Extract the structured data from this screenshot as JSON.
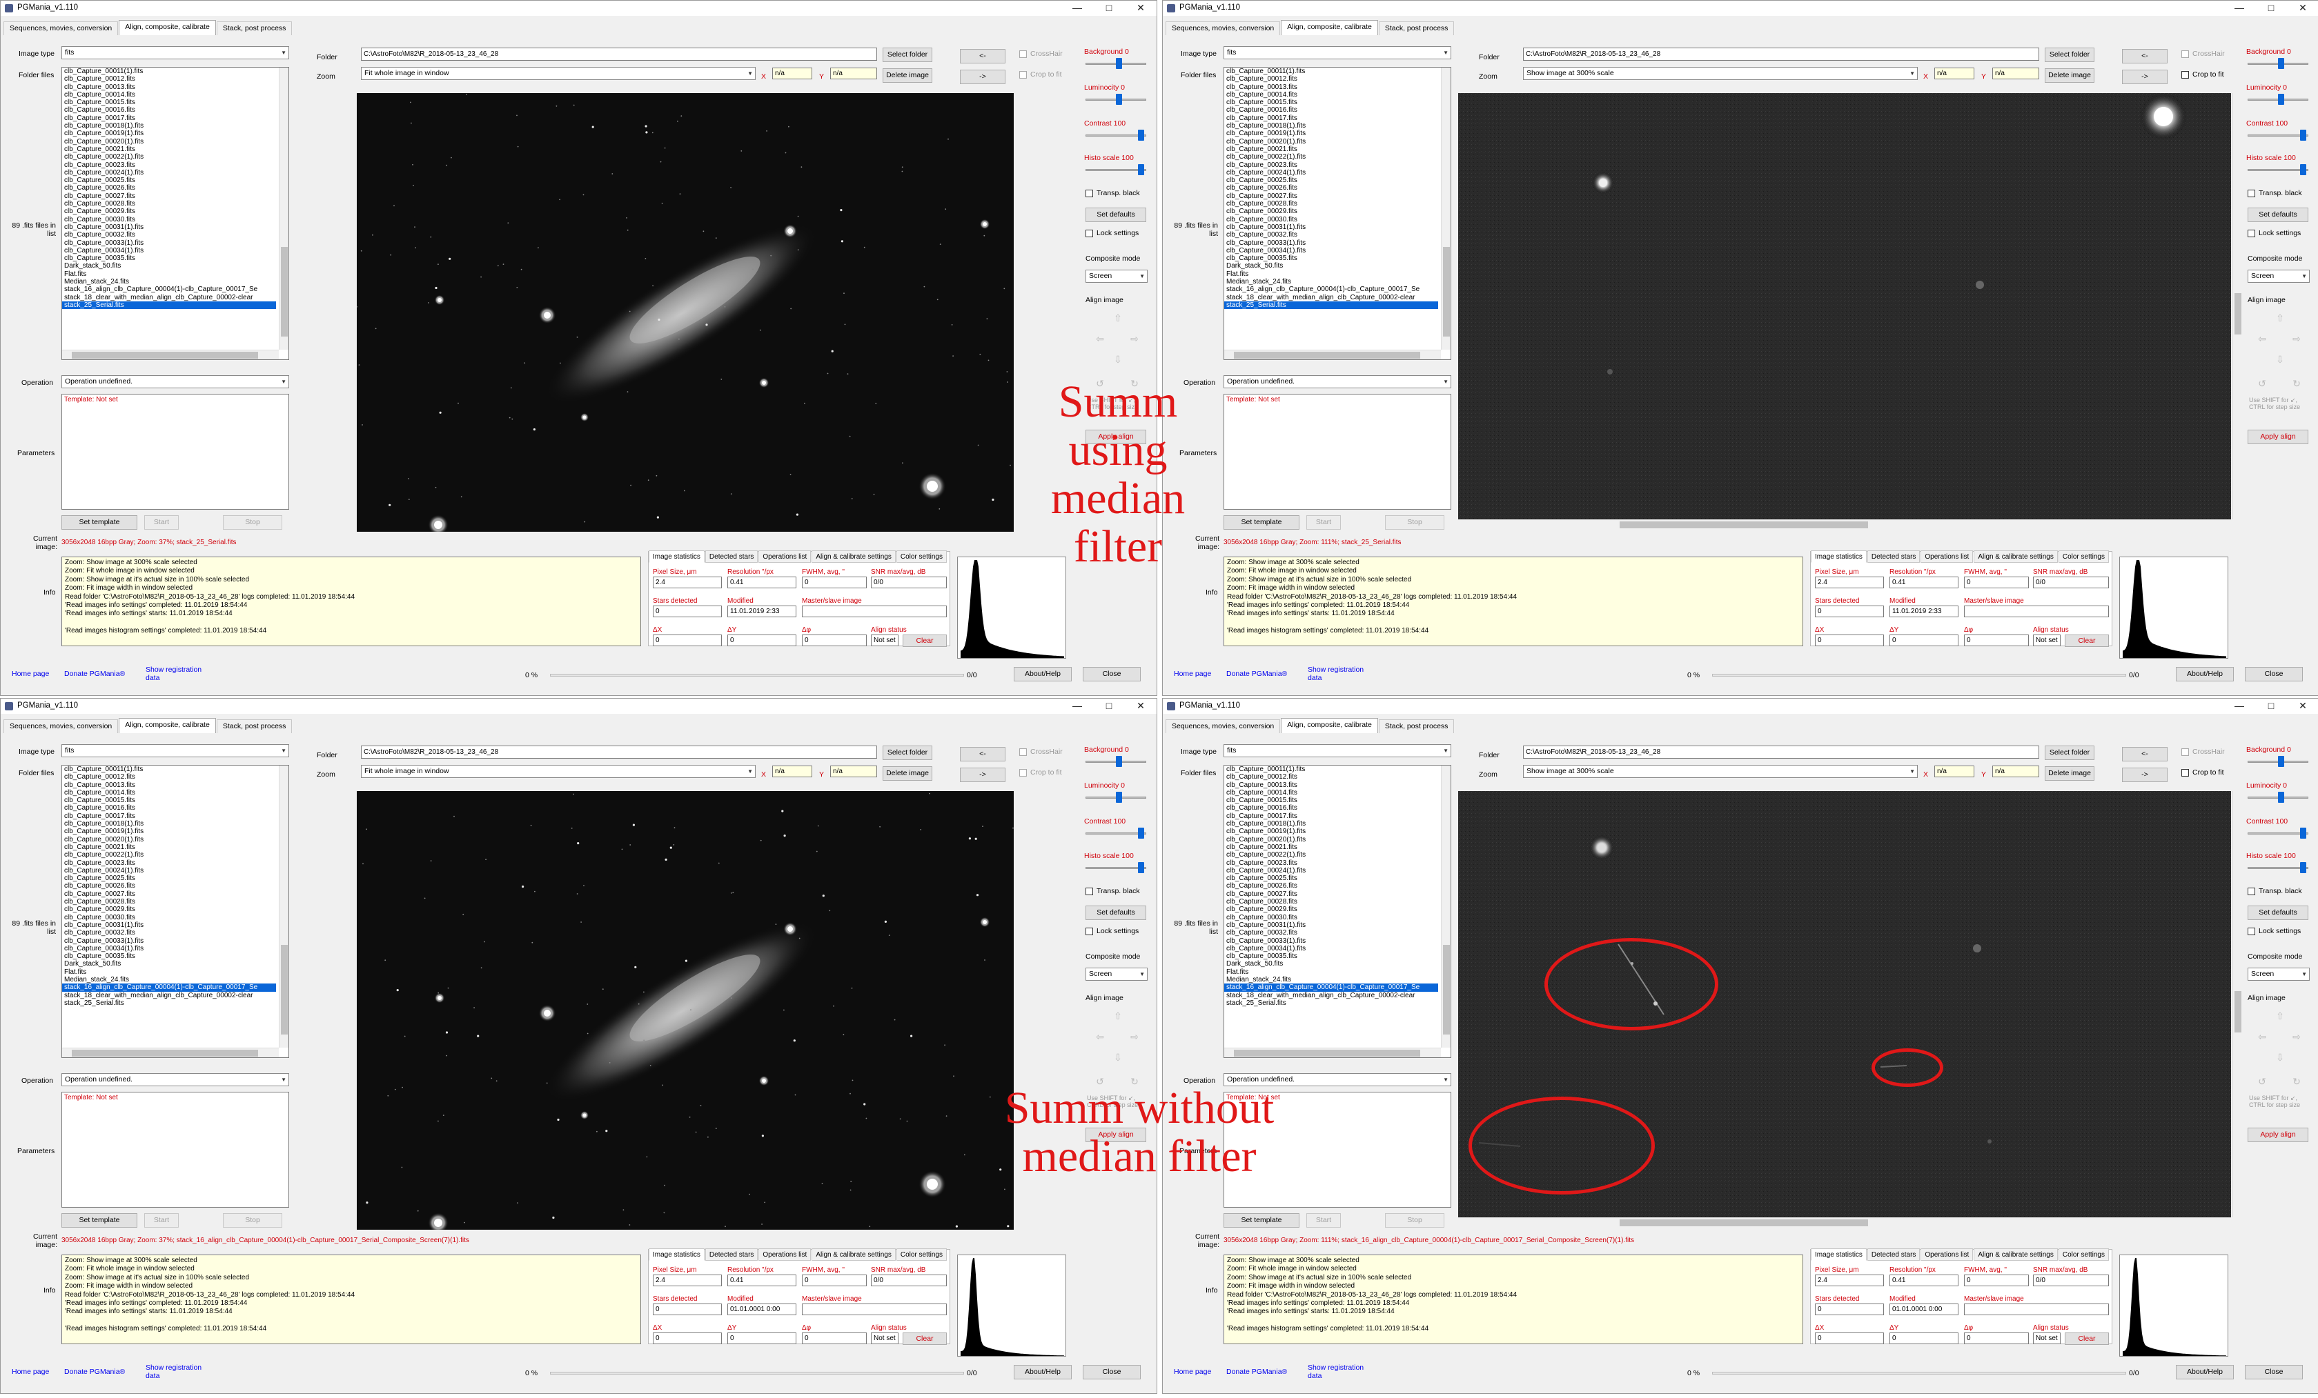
{
  "app": {
    "title": "PGMania_v1.110",
    "tabs": [
      "Sequences, movies, conversion",
      "Align, composite, calibrate",
      "Stack, post process"
    ],
    "labels": {
      "image_type": "Image type",
      "folder_files": "Folder files",
      "files_count": "89 .fits files in list",
      "operation": "Operation",
      "parameters": "Parameters",
      "current_image": "Current image:",
      "info": "Info",
      "folder": "Folder",
      "zoom": "Zoom",
      "x": "X",
      "y": "Y",
      "composite_mode": "Composite mode",
      "align_image": "Align image",
      "transp_black": "Transp. black",
      "lock_settings": "Lock settings",
      "crosshair": "CrossHair",
      "crop_to_fit": "Crop to fit",
      "use_shift": "Use SHIFT for ↙, CTRL for step size",
      "template_not_set": "Template: Not set"
    },
    "buttons": {
      "select_folder": "Select folder",
      "delete_image": "Delete image",
      "nav_prev": "<-",
      "nav_next": "->",
      "set_defaults": "Set defaults",
      "apply_align": "Apply align",
      "set_template": "Set template",
      "start": "Start",
      "stop": "Stop",
      "clear": "Clear",
      "about": "About/Help",
      "close": "Close"
    },
    "sliders": {
      "background": "Background 0",
      "luminosity": "Luminocity 0",
      "contrast": "Contrast 100",
      "histo": "Histo scale 100",
      "background_level": 0.55,
      "luminosity_level": 0.55,
      "contrast_level": 0.95,
      "histo_level": 0.95
    },
    "image_type_value": "fits",
    "operation_value": "Operation undefined.",
    "folder_path": "C:\\AstroFoto\\M82\\R_2018-05-13_23_46_28",
    "xy_value": "n/a",
    "composite_value": "Screen",
    "stats_tabs": [
      "Image statistics",
      "Detected stars",
      "Operations list",
      "Align & calibrate settings",
      "Color settings"
    ],
    "stats_labels": {
      "pixel_size": "Pixel Size, μm",
      "resolution": "Resolution \"/px",
      "fwhm": "FWHM, avg, \"",
      "snr": "SNR max/avg, dB",
      "stars_detected": "Stars detected",
      "modified": "Modified",
      "master": "Master/slave image",
      "dx": "ΔX",
      "dy": "ΔY",
      "dphi": "Δφ",
      "align_status": "Align status"
    },
    "stats_values": {
      "pixel_size": "2.4",
      "resolution": "0.41",
      "fwhm": "0",
      "snr": "0/0",
      "stars": "0",
      "dx": "0",
      "dy": "0",
      "dphi": "0",
      "align_status": "Not set"
    },
    "footer": {
      "home": "Home page",
      "donate": "Donate PGMania®",
      "show_reg": "Show registration data",
      "percent": "0 %",
      "counter": "0/0"
    },
    "info_lines": [
      "Zoom: Show image at 300% scale selected",
      "Zoom: Fit whole image in window selected",
      "Zoom: Show image at it's actual size in 100% scale selected",
      "Zoom: Fit image width in window selected",
      "Read folder 'C:\\AstroFoto\\M82\\R_2018-05-13_23_46_28' logs completed: 11.01.2019 18:54:44",
      "'Read images info settings' completed: 11.01.2019 18:54:44",
      "'Read images info settings' starts: 11.01.2019 18:54:44",
      "",
      "'Read images histogram settings' completed: 11.01.2019 18:54:44"
    ],
    "files_a": [
      "clb_Capture_00011(1).fits",
      "clb_Capture_00012.fits",
      "clb_Capture_00013.fits",
      "clb_Capture_00014.fits",
      "clb_Capture_00015.fits",
      "clb_Capture_00016.fits",
      "clb_Capture_00017.fits",
      "clb_Capture_00018(1).fits",
      "clb_Capture_00019(1).fits",
      "clb_Capture_00020(1).fits",
      "clb_Capture_00021.fits",
      "clb_Capture_00022(1).fits",
      "clb_Capture_00023.fits",
      "clb_Capture_00024(1).fits",
      "clb_Capture_00025.fits",
      "clb_Capture_00026.fits",
      "clb_Capture_00027.fits",
      "clb_Capture_00028.fits",
      "clb_Capture_00029.fits",
      "clb_Capture_00030.fits",
      "clb_Capture_00031(1).fits",
      "clb_Capture_00032.fits",
      "clb_Capture_00033(1).fits",
      "clb_Capture_00034(1).fits",
      "clb_Capture_00035.fits",
      "Dark_stack_50.fits",
      "Flat.fits",
      "Median_stack_24.fits",
      "stack_16_align_clb_Capture_00004(1)-clb_Capture_00017_Se",
      "stack_18_clear_with_median_align_clb_Capture_00002-clear",
      "stack_25_Serial.fits"
    ],
    "files_b": [
      "clb_Capture_00011(1).fits",
      "clb_Capture_00012.fits",
      "clb_Capture_00013.fits",
      "clb_Capture_00014.fits",
      "clb_Capture_00015.fits",
      "clb_Capture_00016.fits",
      "clb_Capture_00017.fits",
      "clb_Capture_00018(1).fits",
      "clb_Capture_00019(1).fits",
      "clb_Capture_00020(1).fits",
      "clb_Capture_00021.fits",
      "clb_Capture_00022(1).fits",
      "clb_Capture_00023.fits",
      "clb_Capture_00024(1).fits",
      "clb_Capture_00025.fits",
      "clb_Capture_00026.fits",
      "clb_Capture_00027.fits",
      "clb_Capture_00028.fits",
      "clb_Capture_00029.fits",
      "clb_Capture_00030.fits",
      "clb_Capture_00031(1).fits",
      "clb_Capture_00032.fits",
      "clb_Capture_00033(1).fits",
      "clb_Capture_00034(1).fits",
      "clb_Capture_00035.fits",
      "Dark_stack_50.fits",
      "Flat.fits",
      "Median_stack_24.fits",
      "stack_16_align_clb_Capture_00004(1)-clb_Capture_00017_Se",
      "stack_18_clear_with_median_align_clb_Capture_00002-clear",
      "stack_25_Serial.fits"
    ]
  },
  "windows": [
    {
      "zoom": "Fit whole image in window",
      "current": "3056x2048 16bpp Gray; Zoom: 37%; stack_25_Serial.fits",
      "modified": "11.01.2019 2:33",
      "selected": 30,
      "view": "full"
    },
    {
      "zoom": "Show image at 300% scale",
      "current": "3056x2048 16bpp Gray; Zoom: 111%; stack_25_Serial.fits",
      "modified": "11.01.2019 2:33",
      "selected": 30,
      "view": "zoom"
    },
    {
      "zoom": "Fit whole image in window",
      "current": "3056x2048 16bpp Gray; Zoom: 37%; stack_16_align_clb_Capture_00004(1)-clb_Capture_00017_Serial_Composite_Screen(7)(1).fits",
      "modified": "01.01.0001 0:00",
      "selected": 28,
      "view": "full"
    },
    {
      "zoom": "Show image at 300% scale",
      "current": "3056x2048 16bpp Gray; Zoom: 111%; stack_16_align_clb_Capture_00004(1)-clb_Capture_00017_Serial_Composite_Screen(7)(1).fits",
      "modified": "01.01.0001 0:00",
      "selected": 28,
      "view": "zoom"
    }
  ],
  "annotations": {
    "top": "Summ using median filter",
    "bottom": "Summ without median filter"
  },
  "colors": {
    "accent": "#0a66d8",
    "annotation": "#e01818",
    "label_red": "#d0000a",
    "info_bg": "#ffffe1"
  }
}
